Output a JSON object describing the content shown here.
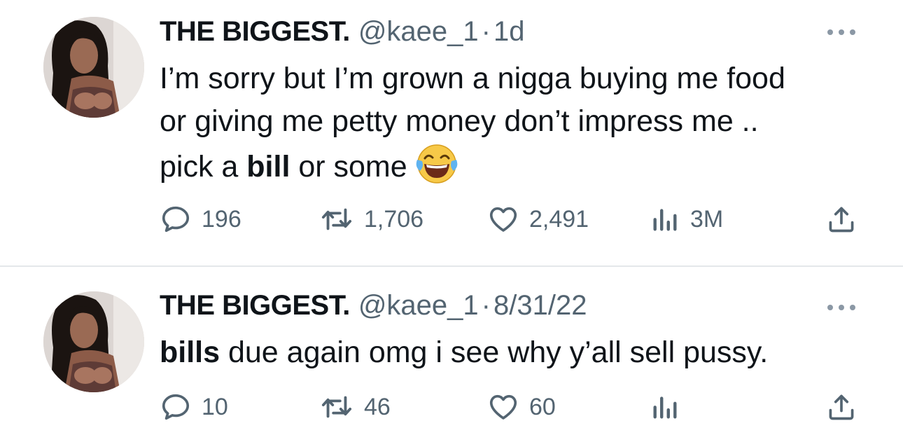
{
  "icons": {
    "reply": "speech-bubble-icon",
    "retweet": "retweet-arrows-icon",
    "like": "heart-outline-icon",
    "views": "bar-chart-icon",
    "share": "share-upload-icon",
    "more": "three-dots-icon",
    "emoji": "face-with-tears-of-joy-emoji"
  },
  "colors": {
    "text": "#0f1419",
    "secondary": "#536471",
    "divider": "#e4e7ea"
  },
  "tweets": [
    {
      "display_name": "THE BIGGEST.",
      "handle": "@kaee_1",
      "separator": "·",
      "time": "1d",
      "text_lines": [
        "I’m sorry but I’m grown a nigga buying me food",
        "or giving me petty money don’t impress me .."
      ],
      "line3_pre": "pick a ",
      "line3_bold": "bill",
      "line3_post": " or some",
      "replies": "196",
      "retweets": "1,706",
      "likes": "2,491",
      "views": "3M"
    },
    {
      "display_name": "THE BIGGEST.",
      "handle": "@kaee_1",
      "separator": "·",
      "time": "8/31/22",
      "text_bold": "bills",
      "text_rest": " due again omg i see why y’all sell pussy.",
      "replies": "10",
      "retweets": "46",
      "likes": "60",
      "views": ""
    }
  ]
}
